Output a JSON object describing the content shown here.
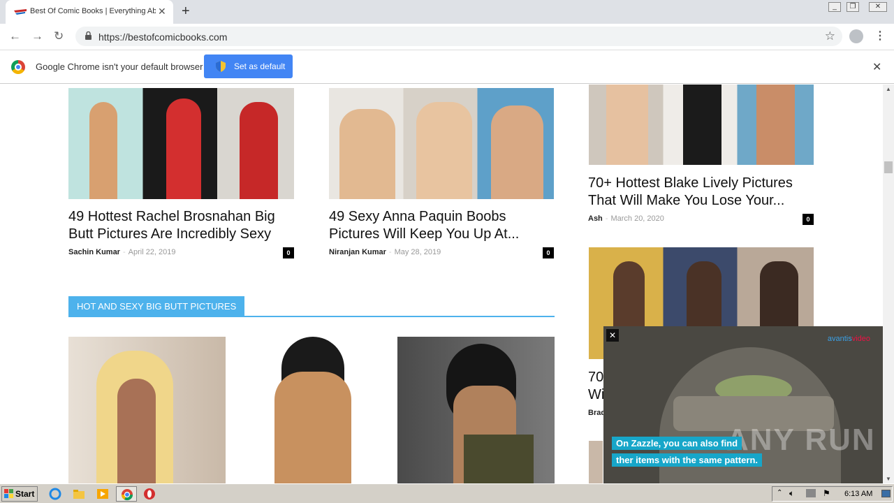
{
  "browser": {
    "tab_title": "Best Of Comic Books | Everything Ab",
    "url": "https://bestofcomicbooks.com",
    "infobar_text": "Google Chrome isn't your default browser",
    "set_default_label": "Set as default"
  },
  "posts": [
    {
      "title_line1": "49 Hottest Rachel Brosnahan Big",
      "title_line2": "Butt Pictures Are Incredibly Sexy",
      "author": "Sachin Kumar",
      "date": "April 22, 2019",
      "comments": "0"
    },
    {
      "title_line1": "49 Sexy Anna Paquin Boobs",
      "title_line2": "Pictures Will Keep You Up At...",
      "author": "Niranjan Kumar",
      "date": "May 28, 2019",
      "comments": "0"
    },
    {
      "title_line1": "70+ Hottest Blake Lively Pictures",
      "title_line2": "That Will Make You Lose Your...",
      "author": "Ash",
      "date": "March 20, 2020",
      "comments": "0"
    },
    {
      "title_line1": "70",
      "title_line2": "Wi",
      "author": "Brad",
      "date": "",
      "comments": ""
    }
  ],
  "section_heading": "HOT AND SEXY BIG BUTT PICTURES",
  "video": {
    "brand_a": "avantis",
    "brand_b": "video",
    "caption_1": "On Zazzle, you can also find",
    "caption_2": "ther items with the same pattern.",
    "watermark": "ANY RUN",
    "close": "✕"
  },
  "taskbar": {
    "start": "Start",
    "clock": "6:13 AM"
  },
  "colors": {
    "accent": "#4db2ec",
    "chrome_blue": "#4285f4"
  }
}
